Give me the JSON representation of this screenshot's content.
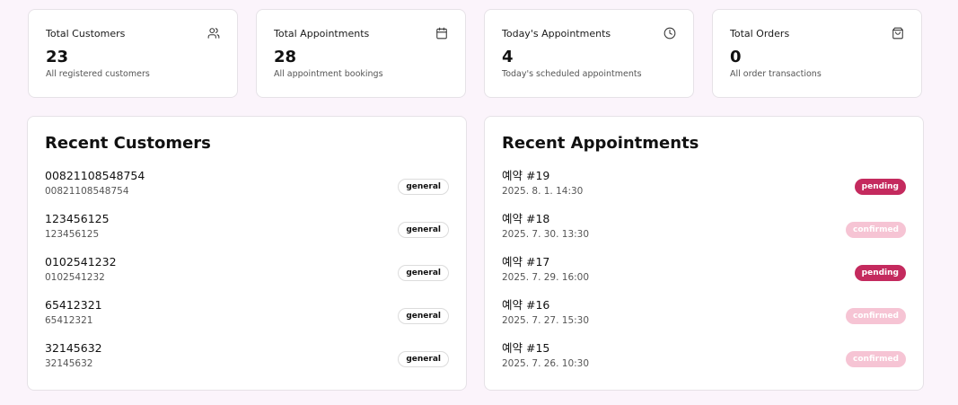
{
  "stats": [
    {
      "title": "Total Customers",
      "value": "23",
      "subtitle": "All registered customers",
      "icon": "users-icon"
    },
    {
      "title": "Total Appointments",
      "value": "28",
      "subtitle": "All appointment bookings",
      "icon": "calendar-icon"
    },
    {
      "title": "Today's Appointments",
      "value": "4",
      "subtitle": "Today's scheduled appointments",
      "icon": "clock-icon"
    },
    {
      "title": "Total Orders",
      "value": "0",
      "subtitle": "All order transactions",
      "icon": "shopping-bag-icon"
    }
  ],
  "recent_customers": {
    "title": "Recent Customers",
    "items": [
      {
        "name": "00821108548754",
        "phone": "00821108548754",
        "badge": "general"
      },
      {
        "name": "123456125",
        "phone": "123456125",
        "badge": "general"
      },
      {
        "name": "0102541232",
        "phone": "0102541232",
        "badge": "general"
      },
      {
        "name": "65412321",
        "phone": "65412321",
        "badge": "general"
      },
      {
        "name": "32145632",
        "phone": "32145632",
        "badge": "general"
      }
    ]
  },
  "recent_appointments": {
    "title": "Recent Appointments",
    "items": [
      {
        "label": "예약 #19",
        "datetime": "2025. 8. 1. 14:30",
        "status": "pending"
      },
      {
        "label": "예약 #18",
        "datetime": "2025. 7. 30. 13:30",
        "status": "confirmed"
      },
      {
        "label": "예약 #17",
        "datetime": "2025. 7. 29. 16:00",
        "status": "pending"
      },
      {
        "label": "예약 #16",
        "datetime": "2025. 7. 27. 15:30",
        "status": "confirmed"
      },
      {
        "label": "예약 #15",
        "datetime": "2025. 7. 26. 10:30",
        "status": "confirmed"
      }
    ]
  },
  "colors": {
    "background": "#fbf4fb",
    "pending": "#c42a5e",
    "confirmed": "#f6c4d4"
  }
}
